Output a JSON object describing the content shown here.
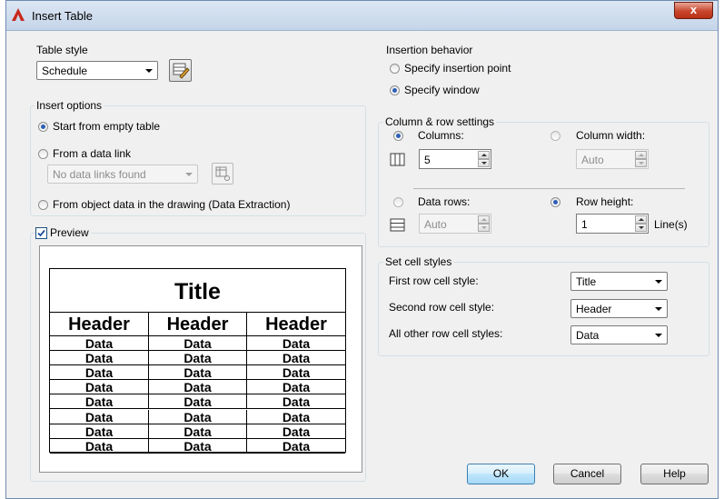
{
  "dialog": {
    "title": "Insert Table",
    "close_label": "x"
  },
  "table_style": {
    "legend": "Table style",
    "selected": "Schedule"
  },
  "insert_options": {
    "legend": "Insert options",
    "start_empty": "Start from empty table",
    "from_data_link": "From a data link",
    "data_link_value": "No data links found",
    "from_object_data": "From object data in the drawing (Data Extraction)",
    "selected": "start_empty"
  },
  "preview": {
    "label": "Preview",
    "checked": true,
    "title": "Title",
    "headers": [
      "Header",
      "Header",
      "Header"
    ],
    "rows": [
      [
        "Data",
        "Data",
        "Data"
      ],
      [
        "Data",
        "Data",
        "Data"
      ],
      [
        "Data",
        "Data",
        "Data"
      ],
      [
        "Data",
        "Data",
        "Data"
      ],
      [
        "Data",
        "Data",
        "Data"
      ],
      [
        "Data",
        "Data",
        "Data"
      ],
      [
        "Data",
        "Data",
        "Data"
      ],
      [
        "Data",
        "Data",
        "Data"
      ]
    ]
  },
  "insertion_behavior": {
    "legend": "Insertion behavior",
    "specify_point": "Specify insertion point",
    "specify_window": "Specify window",
    "selected": "specify_window"
  },
  "column_row": {
    "legend": "Column & row settings",
    "columns_label": "Columns:",
    "columns_value": "5",
    "column_width_label": "Column width:",
    "column_width_value": "Auto",
    "data_rows_label": "Data rows:",
    "data_rows_value": "Auto",
    "row_height_label": "Row height:",
    "row_height_value": "1",
    "row_height_unit": "Line(s)"
  },
  "cell_styles": {
    "legend": "Set cell styles",
    "first_row_label": "First row cell style:",
    "first_row_value": "Title",
    "second_row_label": "Second row cell style:",
    "second_row_value": "Header",
    "other_rows_label": "All other row cell styles:",
    "other_rows_value": "Data"
  },
  "buttons": {
    "ok": "OK",
    "cancel": "Cancel",
    "help": "Help"
  },
  "colors": {
    "accent": "#2e5fb7",
    "titlebar": "#c5d5e9",
    "close": "#c8452c",
    "app_icon": "#c8281e"
  }
}
